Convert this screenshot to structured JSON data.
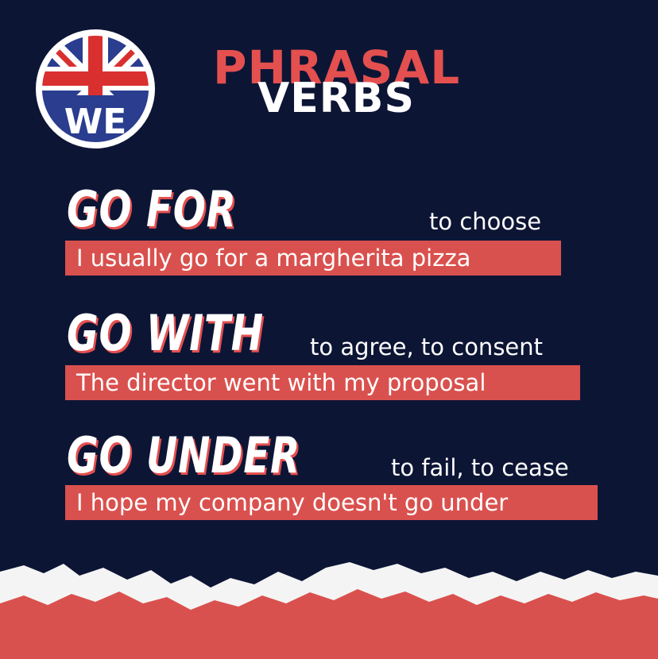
{
  "logo": {
    "text": "WE"
  },
  "title": {
    "line1": "PHRASAL",
    "line2": "VERBS"
  },
  "verbs": [
    {
      "verb": "GO FOR",
      "meaning": "to choose",
      "example": "I usually go for a margherita pizza"
    },
    {
      "verb": "GO WITH",
      "meaning": "to agree, to consent",
      "example": "The director went with my proposal"
    },
    {
      "verb": "GO UNDER",
      "meaning": "to fail, to cease",
      "example": "I hope my company doesn't go under"
    }
  ],
  "colors": {
    "background": "#0d1535",
    "accent": "#e4504f",
    "text": "#ffffff"
  }
}
